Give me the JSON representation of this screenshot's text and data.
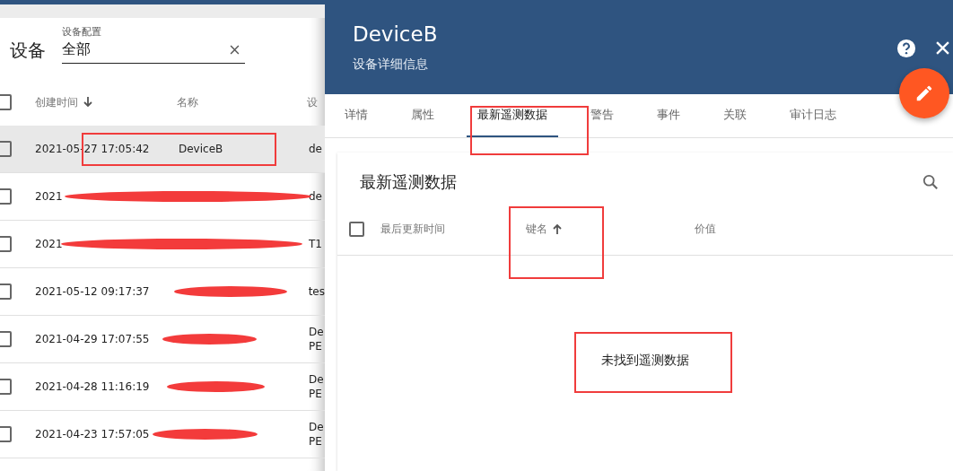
{
  "devices": {
    "title": "设备",
    "filter": {
      "label": "设备配置",
      "value": "全部"
    },
    "columns": [
      "创建时间",
      "名称",
      "设"
    ],
    "all_checked": false,
    "rows": [
      {
        "created": "2021-05-27 17:05:42",
        "name": "DeviceB",
        "col3": [
          "de"
        ],
        "selected": true,
        "checked": false,
        "redacted": false
      },
      {
        "created": "2021",
        "col3": [
          "de"
        ],
        "selected": false,
        "checked": false,
        "redacted": true
      },
      {
        "created": "2021",
        "col3": [
          "T1"
        ],
        "selected": false,
        "checked": false,
        "redacted": true
      },
      {
        "created": "2021-05-12 09:17:37",
        "col3": [
          "tes"
        ],
        "selected": false,
        "checked": false,
        "redacted": true
      },
      {
        "created": "2021-04-29 17:07:55",
        "col3": [
          "De",
          "PE"
        ],
        "selected": false,
        "checked": false,
        "redacted": true
      },
      {
        "created": "2021-04-28 11:16:19",
        "col3": [
          "De",
          "PE"
        ],
        "selected": false,
        "checked": false,
        "redacted": true
      },
      {
        "created": "2021-04-23 17:57:05",
        "col3": [
          "De",
          "PE"
        ],
        "selected": false,
        "checked": false,
        "redacted": true
      }
    ]
  },
  "details": {
    "title": "DeviceB",
    "subtitle": "设备详细信息",
    "tabs": [
      {
        "label": "详情",
        "selected": false
      },
      {
        "label": "属性",
        "selected": false
      },
      {
        "label": "最新遥测数据",
        "selected": true
      },
      {
        "label": "警告",
        "selected": false
      },
      {
        "label": "事件",
        "selected": false
      },
      {
        "label": "关联",
        "selected": false
      },
      {
        "label": "审计日志",
        "selected": false
      }
    ],
    "card": {
      "title": "最新遥测数据",
      "columns": [
        "最后更新时间",
        "键名",
        "价值"
      ],
      "all_checked": false,
      "empty_text": "未找到遥测数据"
    }
  }
}
